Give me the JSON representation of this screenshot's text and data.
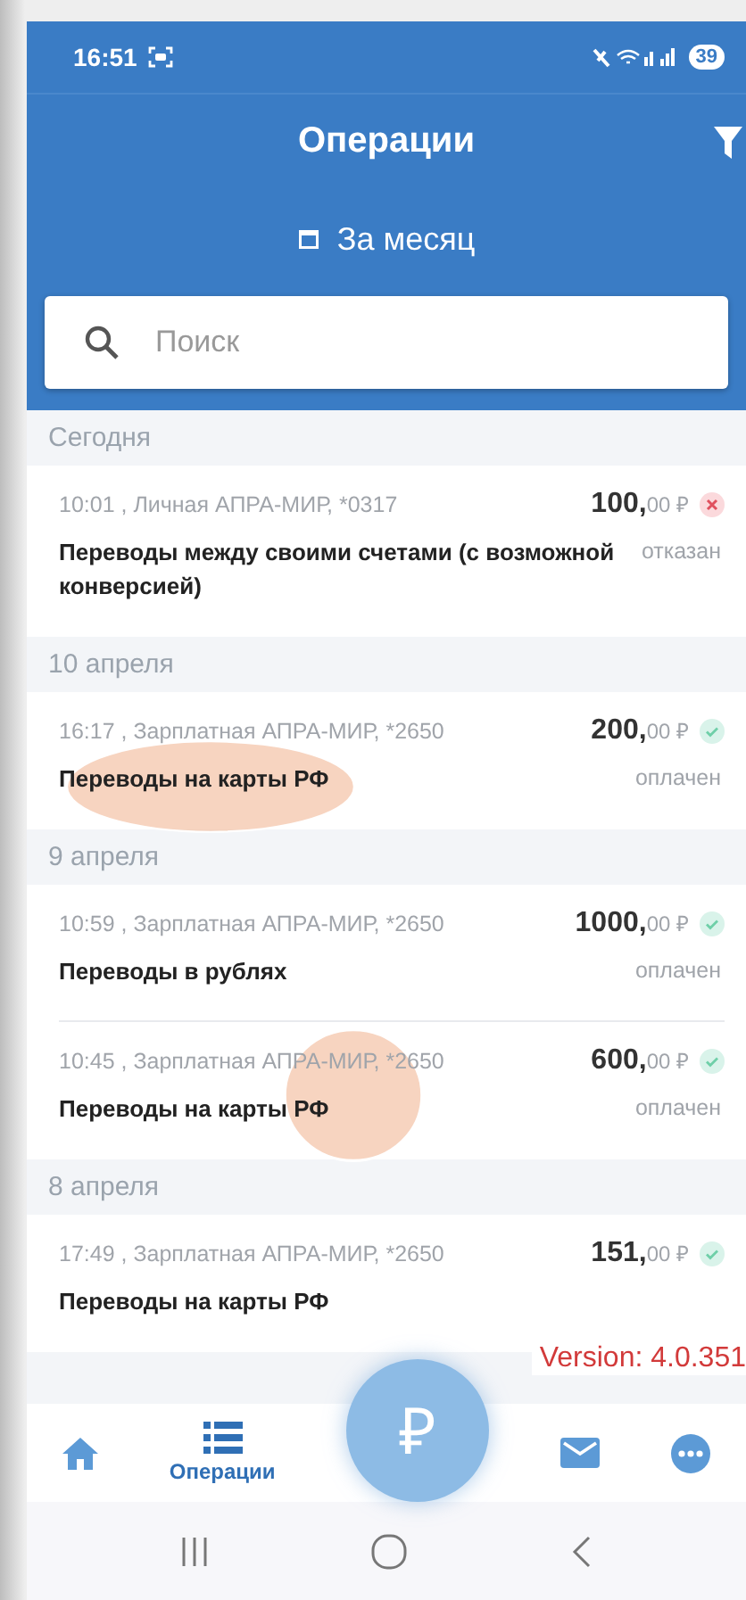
{
  "status_bar": {
    "time": "16:51",
    "battery": "39"
  },
  "header": {
    "title": "Операции",
    "period": "За месяц"
  },
  "search": {
    "placeholder": "Поиск"
  },
  "sections": [
    {
      "date": "Сегодня",
      "items": [
        {
          "meta": "10:01 , Личная АПРА-МИР, *0317",
          "amount": "**100,**00 ₽",
          "rejected": true,
          "touched": false,
          "title": "Переводы между своими счетами (с возможной конверсией)",
          "status": "отказан"
        }
      ]
    },
    {
      "date": "10 апреля",
      "items": [
        {
          "meta": "16:17 , Зарплатная АПРА-МИР, *2650",
          "amount": "**200,**00 ₽",
          "rejected": false,
          "touched": true,
          "title": "Переводы на карты РФ",
          "status": "оплачен"
        }
      ]
    },
    {
      "date": "9 апреля",
      "items": [
        {
          "meta": "10:59 , Зарплатная АПРА-МИР, *2650",
          "amount": "**1000,**00 ₽",
          "rejected": false,
          "touched": false,
          "title": "Переводы в рублях",
          "status": "оплачен"
        },
        {
          "meta": "10:45 , Зарплатная АПРА-МИР, *2650",
          "amount": "**600,**00 ₽",
          "rejected": false,
          "touched": true,
          "title": "Переводы на карты РФ",
          "status": "оплачен"
        }
      ]
    },
    {
      "date": "8 апреля",
      "items": [
        {
          "meta": "17:49 , Зарплатная АПРА-МИР, *2650",
          "amount": "**151,**00 ₽",
          "rejected": false,
          "touched": false,
          "title": "Переводы на карты РФ"
        }
      ]
    }
  ],
  "version": "Version: 4.0.351",
  "bottom_nav": [
    {
      "kind": "home",
      "selected": false
    },
    {
      "kind": "list",
      "label": "Операции",
      "selected": true
    },
    {
      "kind": "pay",
      "label": "₽",
      "selected": false
    },
    {
      "kind": "mail",
      "selected": false
    },
    {
      "kind": "more",
      "selected": false
    }
  ]
}
